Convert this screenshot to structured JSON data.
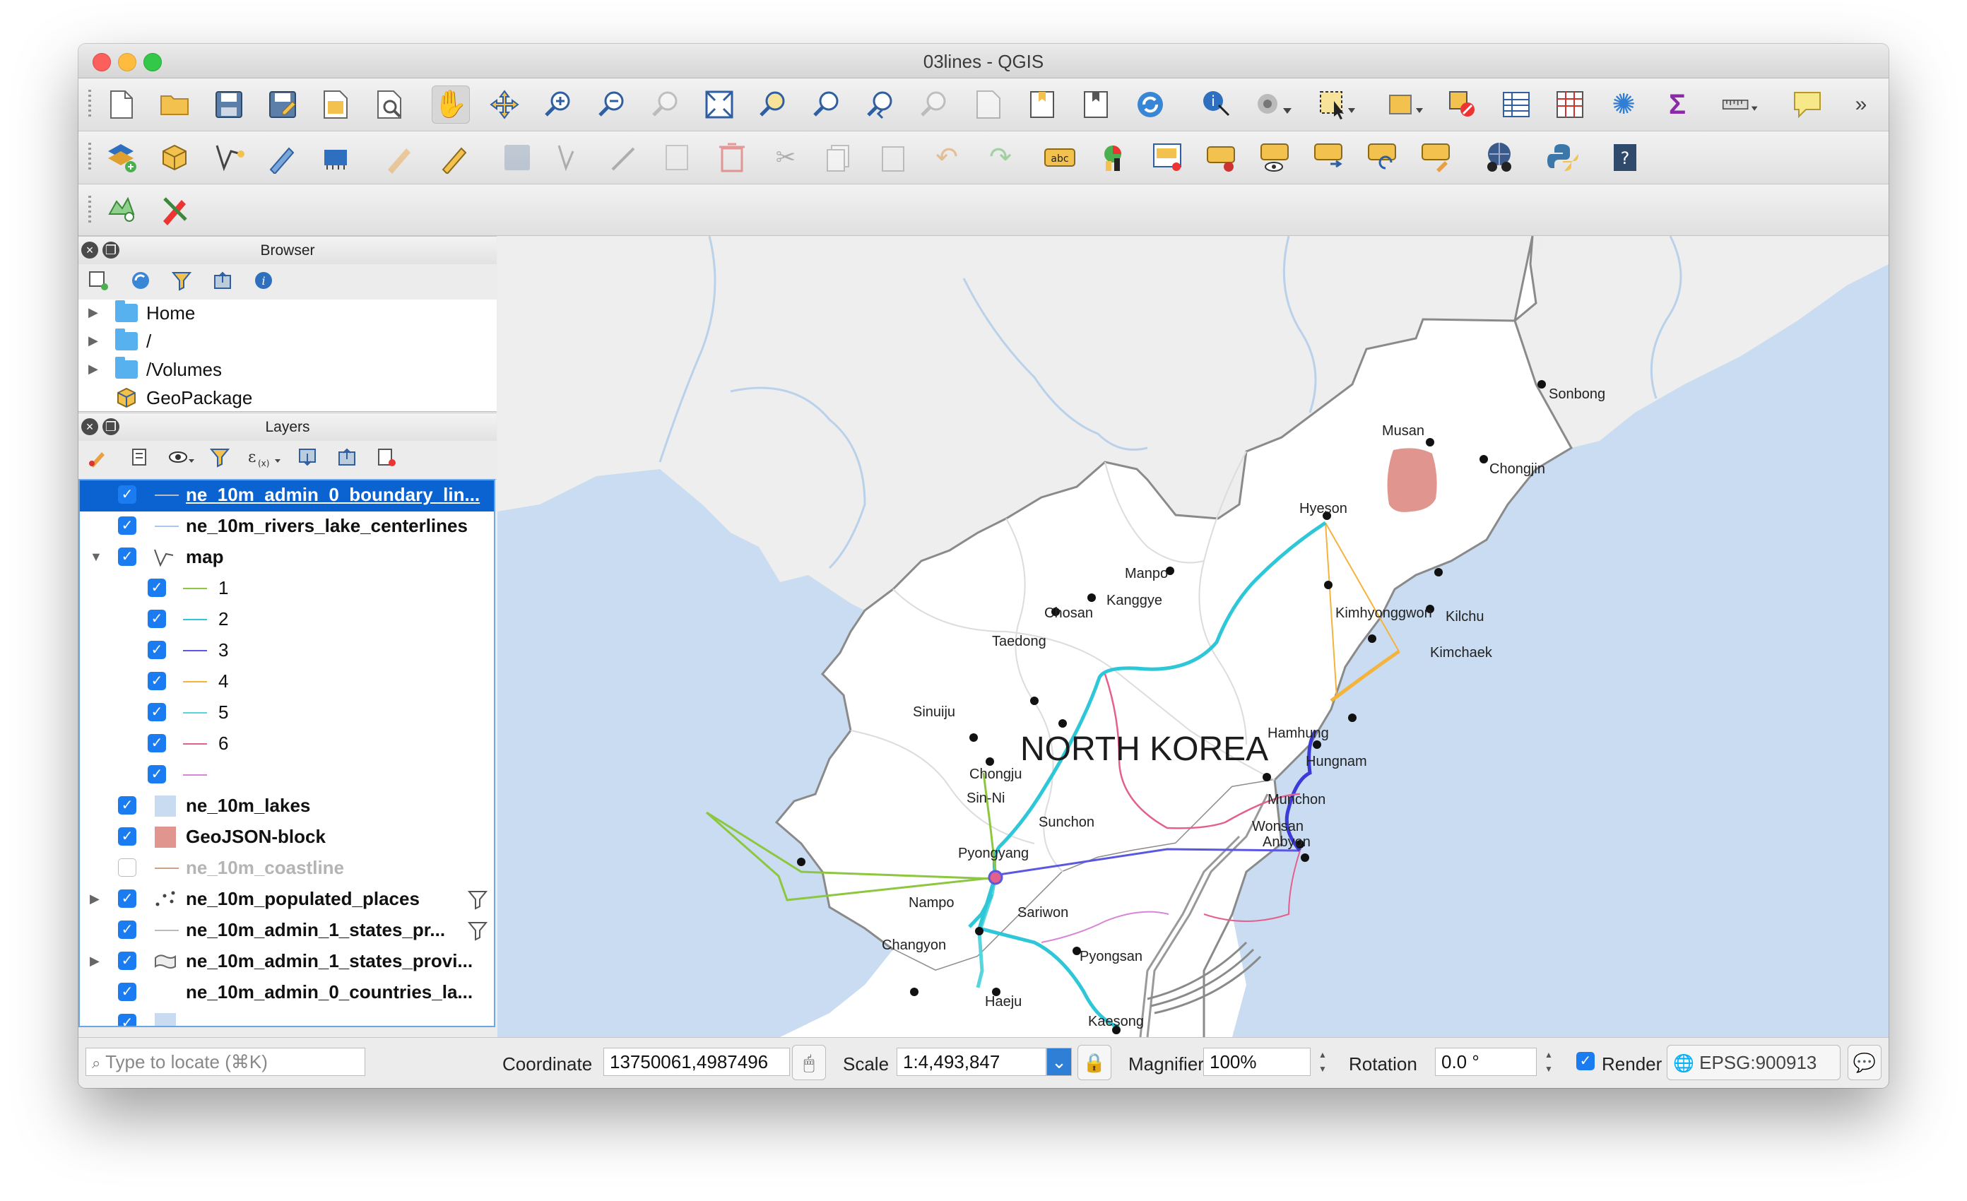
{
  "window": {
    "title": "03lines - QGIS"
  },
  "toolbars": {
    "row1": [
      "new-project",
      "open-project",
      "save-project",
      "save-as",
      "print-layout",
      "layout-manager",
      "pan",
      "pan-to-selection",
      "zoom-in",
      "zoom-out",
      "zoom-native",
      "zoom-full",
      "zoom-to-selection",
      "zoom-to-layer",
      "zoom-last",
      "zoom-next",
      "new-bookmark",
      "show-bookmarks",
      "new-map-view",
      "refresh",
      "identify",
      "actions",
      "select-features",
      "open-attribute-table",
      "deselect",
      "attribute-table",
      "field-calculator",
      "statistics",
      "sum",
      "measure",
      "annotation",
      "more"
    ],
    "row2": [
      "add-layer",
      "data-source-manager",
      "digitize-vertex",
      "digitize-freehand",
      "virtual-layer",
      "current-edits",
      "toggle-editing",
      "save-edits",
      "vertex-tool",
      "node-tool",
      "modify-attributes",
      "delete-selected",
      "cut-features",
      "copy-features",
      "paste-features",
      "undo",
      "redo",
      "label-abc",
      "layer-diagram",
      "label-pin",
      "label-show-hide",
      "label-move",
      "label-rotate",
      "label-change",
      "label-properties",
      "georeferencer",
      "python-console",
      "help"
    ],
    "row3": [
      "processing-toolbox",
      "digitizing-tools"
    ]
  },
  "browser": {
    "title": "Browser",
    "items": [
      {
        "label": "Home",
        "type": "folder"
      },
      {
        "label": "/",
        "type": "folder"
      },
      {
        "label": "/Volumes",
        "type": "folder"
      },
      {
        "label": "GeoPackage",
        "type": "geopackage"
      }
    ]
  },
  "layers": {
    "title": "Layers",
    "items": [
      {
        "label": "ne_10m_admin_0_boundary_lin...",
        "checked": true,
        "selected": true,
        "symbol": "line",
        "color": "#bbbbbb",
        "bold": true
      },
      {
        "label": "ne_10m_rivers_lake_centerlines",
        "checked": true,
        "symbol": "line",
        "color": "#a9c8ea",
        "bold": true
      },
      {
        "label": "map",
        "checked": true,
        "symbol": "lines-group",
        "color": "#555555",
        "bold": true,
        "expanded": true
      },
      {
        "label": "1",
        "checked": true,
        "symbol": "line",
        "color": "#8dc63f",
        "indent": true
      },
      {
        "label": "2",
        "checked": true,
        "symbol": "line",
        "color": "#2ec7d8",
        "indent": true
      },
      {
        "label": "3",
        "checked": true,
        "symbol": "line",
        "color": "#5a57e0",
        "indent": true
      },
      {
        "label": "4",
        "checked": true,
        "symbol": "line",
        "color": "#f4b33c",
        "indent": true
      },
      {
        "label": "5",
        "checked": true,
        "symbol": "line",
        "color": "#55d6dc",
        "indent": true
      },
      {
        "label": "6",
        "checked": true,
        "symbol": "line",
        "color": "#e4608c",
        "indent": true
      },
      {
        "label": "",
        "checked": true,
        "symbol": "line",
        "color": "#d884d8",
        "indent": true
      },
      {
        "label": "ne_10m_lakes",
        "checked": true,
        "symbol": "fill",
        "color": "#c8dbf1",
        "bold": true
      },
      {
        "label": "GeoJSON-block",
        "checked": true,
        "symbol": "fill",
        "color": "#e0968f",
        "bold": true
      },
      {
        "label": "ne_10m_coastline",
        "checked": false,
        "symbol": "line",
        "color": "#c8a58a",
        "grey": true
      },
      {
        "label": "ne_10m_populated_places",
        "checked": true,
        "symbol": "points",
        "color": "#555555",
        "bold": true,
        "collapsed": true,
        "filter": true
      },
      {
        "label": "ne_10m_admin_1_states_pr...",
        "checked": true,
        "symbol": "line",
        "color": "#bbbbbb",
        "bold": true,
        "filter": true
      },
      {
        "label": "ne_10m_admin_1_states_provi...",
        "checked": true,
        "symbol": "poly",
        "color": "#dddddd",
        "bold": true,
        "collapsed": true
      },
      {
        "label": "ne_10m_admin_0_countries_la...",
        "checked": true,
        "symbol": "none",
        "color": "#ffffff",
        "bold": true
      }
    ]
  },
  "map": {
    "country_label": "NORTH KOREA",
    "cities": [
      "Musan",
      "Sonbong",
      "Chongjin",
      "Hyeson",
      "Manpo",
      "Kanggye",
      "Chosan",
      "Kimhyonggwon",
      "Kilchu",
      "Taedong",
      "Kimchaek",
      "Sinuiju",
      "Hamhung",
      "Hungnam",
      "Chongju",
      "Sin-Ni",
      "Sunchon",
      "Munchon",
      "Wonsan",
      "Pyongyang",
      "Anbyon",
      "Nampo",
      "Sariwon",
      "Changyon",
      "Pyongsan",
      "Haeju",
      "Kaesong"
    ],
    "colors": {
      "sea": "#c9dcf1",
      "land": "#ffffff",
      "neighbor": "#ececec",
      "border": "#8a8a8a",
      "block": "#e0968f"
    }
  },
  "status": {
    "locate_placeholder": "Type to locate (⌘K)",
    "coordinate_label": "Coordinate",
    "coordinate_value": "13750061,4987496",
    "scale_label": "Scale",
    "scale_value": "1:4,493,847",
    "magnifier_label": "Magnifier",
    "magnifier_value": "100%",
    "rotation_label": "Rotation",
    "rotation_value": "0.0 °",
    "render_label": "Render",
    "render_checked": true,
    "crs": "EPSG:900913"
  }
}
